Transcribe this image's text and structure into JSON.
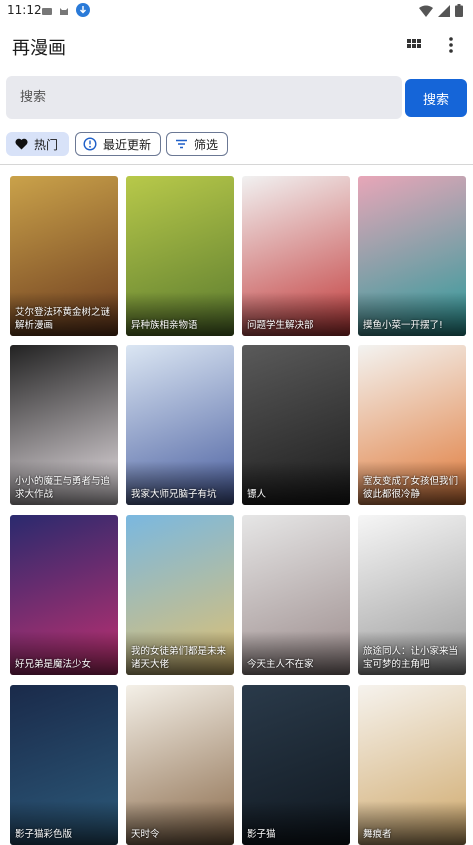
{
  "status_bar": {
    "time": "11:12"
  },
  "app_bar": {
    "title": "再漫画"
  },
  "search": {
    "placeholder": "搜索",
    "button_label": "搜索"
  },
  "chips": [
    {
      "label": "热门",
      "selected": true,
      "icon": "heart-icon"
    },
    {
      "label": "最近更新",
      "selected": false,
      "icon": "clock-icon"
    },
    {
      "label": "筛选",
      "selected": false,
      "icon": "filter-icon"
    }
  ],
  "comics": [
    {
      "title": "艾尔登法环黄金树之谜解析漫画",
      "colors": [
        "#caa24a",
        "#6b3a1e"
      ]
    },
    {
      "title": "异种族相亲物语",
      "colors": [
        "#b8c94a",
        "#5a7a2e"
      ]
    },
    {
      "title": "问题学生解决部",
      "colors": [
        "#f1f1f1",
        "#c23a3a"
      ]
    },
    {
      "title": "摸鱼小菜一开摆了!",
      "colors": [
        "#e8a6b8",
        "#2a9a9a"
      ]
    },
    {
      "title": "小小的魔王与勇者与追求大作战",
      "colors": [
        "#222222",
        "#e9e2e6"
      ]
    },
    {
      "title": "我家大师兄脑子有坑",
      "colors": [
        "#dbe6f3",
        "#4a5fa0"
      ]
    },
    {
      "title": "镖人",
      "colors": [
        "#5a5a5a",
        "#1c1c1c"
      ]
    },
    {
      "title": "室友变成了女孩但我们彼此都很冷静",
      "colors": [
        "#f3f3f1",
        "#e07a3a"
      ]
    },
    {
      "title": "好兄弟是魔法少女",
      "colors": [
        "#2a2a6e",
        "#c03070"
      ]
    },
    {
      "title": "我的女徒弟们都是未来诸天大佬",
      "colors": [
        "#7ab8e0",
        "#e0c070"
      ]
    },
    {
      "title": "今天主人不在家",
      "colors": [
        "#e6e6e6",
        "#9a8a8a"
      ]
    },
    {
      "title": "旅途同人：让小家来当宝可梦的主角吧",
      "colors": [
        "#f6f6f6",
        "#9a9a9a"
      ]
    },
    {
      "title": "影子猫彩色版",
      "colors": [
        "#1a2a4a",
        "#2c5a7a"
      ]
    },
    {
      "title": "天时令",
      "colors": [
        "#f4f0e8",
        "#8a6a4a"
      ]
    },
    {
      "title": "影子猫",
      "colors": [
        "#2a3a4a",
        "#101820"
      ]
    },
    {
      "title": "舞痕者",
      "colors": [
        "#f6f3ee",
        "#cfa86a"
      ]
    }
  ]
}
